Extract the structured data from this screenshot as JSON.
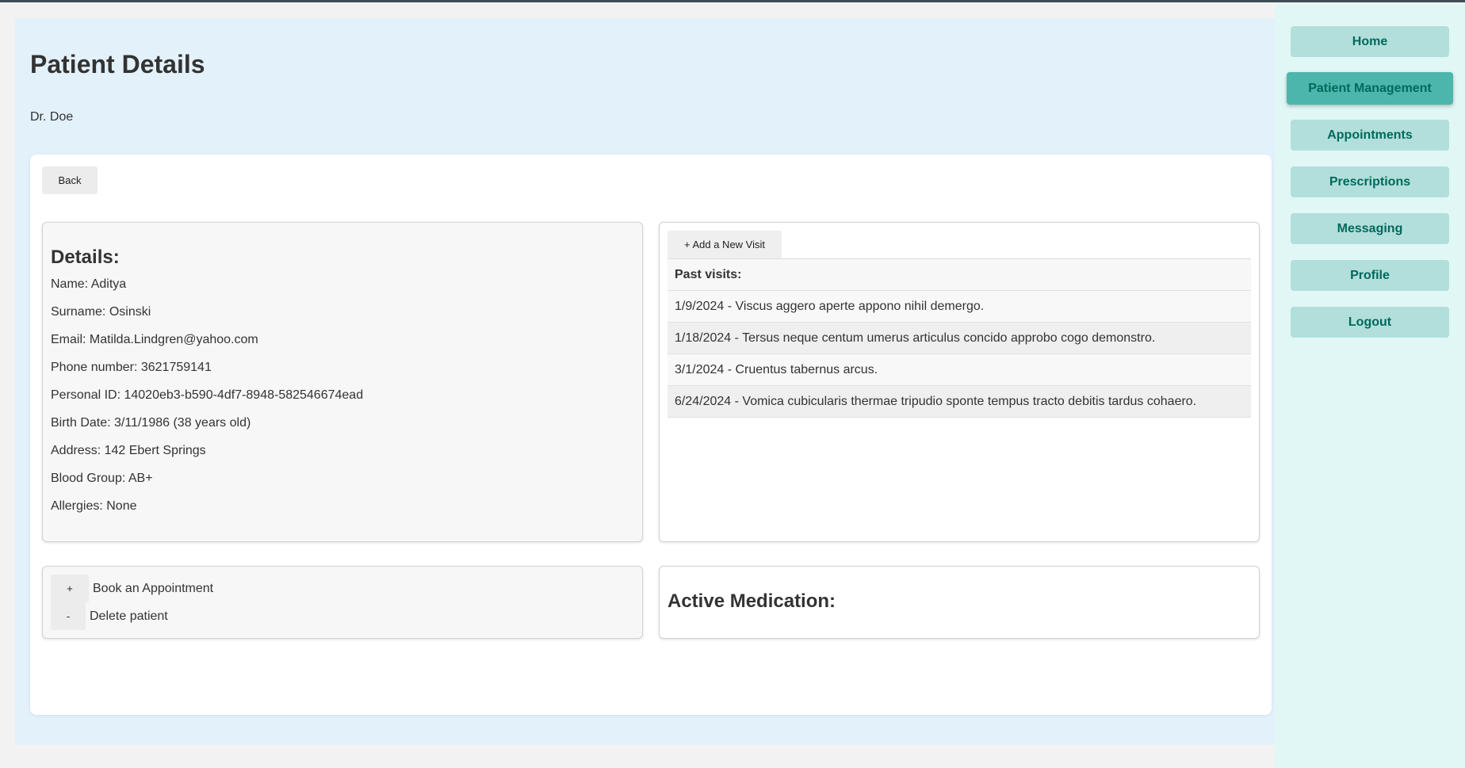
{
  "header": {
    "title": "Patient Details",
    "doctor": "Dr. Doe"
  },
  "toolbar": {
    "back_label": "Back"
  },
  "details": {
    "heading": "Details:",
    "lines": [
      "Name: Aditya",
      "Surname: Osinski",
      "Email: Matilda.Lindgren@yahoo.com",
      "Phone number: 3621759141",
      "Personal ID: 14020eb3-b590-4df7-8948-582546674ead",
      "Birth Date: 3/11/1986 (38 years old)",
      "Address: 142 Ebert Springs",
      "Blood Group: AB+",
      "Allergies: None"
    ]
  },
  "visits": {
    "add_label": "+ Add a New Visit",
    "header": "Past visits:",
    "items": [
      "1/9/2024 - Viscus aggero aperte appono nihil demergo.",
      "1/18/2024 - Tersus neque centum umerus articulus concido approbo cogo demonstro.",
      "3/1/2024 - Cruentus tabernus arcus.",
      "6/24/2024 - Vomica cubicularis thermae tripudio sponte tempus tracto debitis tardus cohaero."
    ]
  },
  "actions": {
    "book_symbol": "+",
    "book_label": "Book an Appointment",
    "delete_symbol": "-",
    "delete_label": "Delete patient"
  },
  "medication": {
    "heading": "Active Medication:"
  },
  "sidebar": {
    "items": [
      {
        "label": "Home",
        "active": false
      },
      {
        "label": "Patient Management",
        "active": true
      },
      {
        "label": "Appointments",
        "active": false
      },
      {
        "label": "Prescriptions",
        "active": false
      },
      {
        "label": "Messaging",
        "active": false
      },
      {
        "label": "Profile",
        "active": false
      },
      {
        "label": "Logout",
        "active": false
      }
    ]
  },
  "colors": {
    "main_background": "#e3f1fb",
    "sidebar_background": "#e0f7f6",
    "nav_button": "#b2dfdb",
    "nav_button_active": "#4db6ac",
    "nav_text": "#00695c"
  }
}
